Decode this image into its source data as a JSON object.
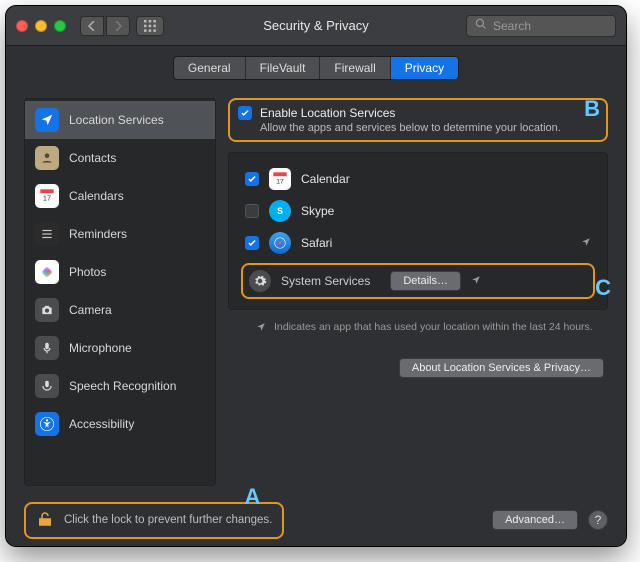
{
  "window": {
    "title": "Security & Privacy"
  },
  "search": {
    "placeholder": "Search"
  },
  "tabs": [
    {
      "label": "General",
      "selected": false
    },
    {
      "label": "FileVault",
      "selected": false
    },
    {
      "label": "Firewall",
      "selected": false
    },
    {
      "label": "Privacy",
      "selected": true
    }
  ],
  "sidebar": {
    "items": [
      {
        "label": "Location Services"
      },
      {
        "label": "Contacts"
      },
      {
        "label": "Calendars"
      },
      {
        "label": "Reminders"
      },
      {
        "label": "Photos"
      },
      {
        "label": "Camera"
      },
      {
        "label": "Microphone"
      },
      {
        "label": "Speech Recognition"
      },
      {
        "label": "Accessibility"
      }
    ]
  },
  "content": {
    "enable_label": "Enable Location Services",
    "enable_sub": "Allow the apps and services below to determine your location.",
    "apps": [
      {
        "label": "Calendar",
        "checked": true
      },
      {
        "label": "Skype",
        "checked": false
      },
      {
        "label": "Safari",
        "checked": true
      }
    ],
    "system_services_label": "System Services",
    "details_label": "Details…",
    "hint": "Indicates an app that has used your location within the last 24 hours.",
    "about_label": "About Location Services & Privacy…"
  },
  "footer": {
    "lock_text": "Click the lock to prevent further changes.",
    "advanced_label": "Advanced…"
  },
  "annotations": {
    "a": "A",
    "b": "B",
    "c": "C"
  },
  "colors": {
    "accent": "#1473e6",
    "highlight": "#e2961c",
    "label": "#65c8ff"
  }
}
